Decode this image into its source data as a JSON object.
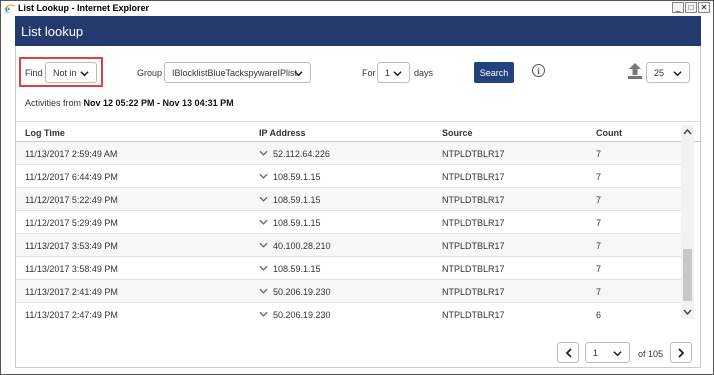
{
  "window": {
    "title": "List Lookup - Internet Explorer",
    "controls": {
      "minimize": "_",
      "maximize": "□",
      "close": "✕"
    }
  },
  "app": {
    "title": "List lookup"
  },
  "filters": {
    "find_label": "Find",
    "find_value": "Not in",
    "group_label": "Group",
    "group_value": "IBlocklistBlueTackspywareIPlist",
    "for_label": "For",
    "days_value": "1",
    "days_label": "days",
    "search_label": "Search",
    "info_glyph": "i",
    "page_size": "25"
  },
  "activities": {
    "prefix": "Activities from ",
    "range": "Nov 12 05:22 PM - Nov 13 04:31 PM"
  },
  "table": {
    "columns": [
      "Log Time",
      "IP Address",
      "Source",
      "Count"
    ],
    "rows": [
      {
        "log_time": "11/13/2017 2:59:49 AM",
        "ip": "52.112.64.226",
        "source": "NTPLDTBLR17",
        "count": "7"
      },
      {
        "log_time": "11/12/2017 6:44:49 PM",
        "ip": "108.59.1.15",
        "source": "NTPLDTBLR17",
        "count": "7"
      },
      {
        "log_time": "11/12/2017 5:22:49 PM",
        "ip": "108.59.1.15",
        "source": "NTPLDTBLR17",
        "count": "7"
      },
      {
        "log_time": "11/12/2017 5:29:49 PM",
        "ip": "108.59.1.15",
        "source": "NTPLDTBLR17",
        "count": "7"
      },
      {
        "log_time": "11/13/2017 3:53:49 PM",
        "ip": "40.100.28.210",
        "source": "NTPLDTBLR17",
        "count": "7"
      },
      {
        "log_time": "11/13/2017 3:58:49 PM",
        "ip": "108.59.1.15",
        "source": "NTPLDTBLR17",
        "count": "7"
      },
      {
        "log_time": "11/13/2017 2:41:49 PM",
        "ip": "50.206.19.230",
        "source": "NTPLDTBLR17",
        "count": "7"
      },
      {
        "log_time": "11/13/2017 2:47:49 PM",
        "ip": "50.206.19.230",
        "source": "NTPLDTBLR17",
        "count": "6"
      }
    ]
  },
  "pagination": {
    "current_page": "1",
    "of_text": "of 105"
  },
  "icons": {
    "ie_logo": "ie-logo-icon",
    "chevron": "chevron-down-icon",
    "info": "info-icon",
    "upload": "upload-icon"
  },
  "colors": {
    "header_bg": "#243a6e",
    "search_button": "#22417f",
    "highlight": "#e04040"
  }
}
